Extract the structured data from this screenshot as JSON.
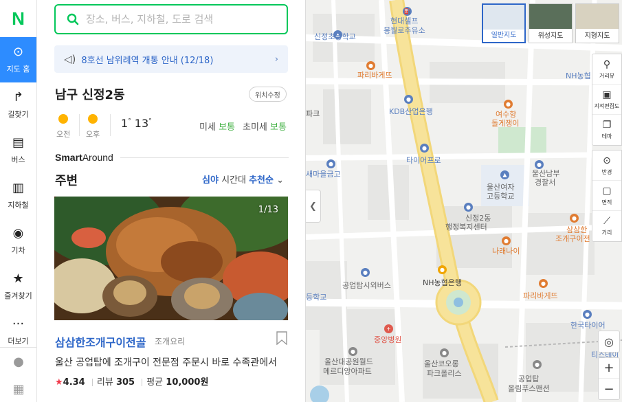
{
  "nav": {
    "logo": "N",
    "items": [
      {
        "label": "지도 홈",
        "icon": "map-home-icon",
        "glyph": "⊙",
        "active": true
      },
      {
        "label": "길찾기",
        "icon": "directions-icon",
        "glyph": "↱",
        "active": false
      },
      {
        "label": "버스",
        "icon": "bus-icon",
        "glyph": "▤",
        "active": false
      },
      {
        "label": "지하철",
        "icon": "subway-icon",
        "glyph": "▥",
        "active": false
      },
      {
        "label": "기차",
        "icon": "train-icon",
        "glyph": "◉",
        "active": false
      },
      {
        "label": "즐겨찾기",
        "icon": "star-icon",
        "glyph": "★",
        "active": false
      },
      {
        "label": "더보기",
        "icon": "more-icon",
        "glyph": "···",
        "active": false
      }
    ],
    "bottom": [
      {
        "icon": "profile-icon",
        "glyph": "●"
      },
      {
        "icon": "grid-icon",
        "glyph": "▦"
      }
    ]
  },
  "search": {
    "placeholder": "장소, 버스, 지하철, 도로 검색",
    "value": ""
  },
  "notice": {
    "text": "8호선 남위례역 개통 안내 (12/18)"
  },
  "location": {
    "name": "남구 신정2동",
    "edit_button": "위치수정"
  },
  "weather": {
    "am_label": "오전",
    "pm_label": "오후",
    "low": "1",
    "high": "13",
    "degree": "°",
    "fine_dust_label": "미세",
    "fine_dust_value": "보통",
    "ultra_dust_label": "초미세",
    "ultra_dust_value": "보통"
  },
  "smart_around": {
    "brand_bold": "Smart",
    "brand_rest": "Around"
  },
  "around": {
    "title": "주변",
    "filter_time": "심야",
    "filter_mid": "시간대",
    "filter_sort": "추천순"
  },
  "place": {
    "photo_count": "1/13",
    "name": "삼삼한조개구이전골",
    "category": "조개요리",
    "description": "울산 공업탑에 조개구이 전문점 주문시 바로 수족관에서",
    "rating": "4.34",
    "review_label": "리뷰",
    "review_count": "305",
    "price_label": "평균",
    "price": "10,000원"
  },
  "map_layers": [
    {
      "label": "일반지도",
      "selected": true
    },
    {
      "label": "위성지도",
      "selected": false
    },
    {
      "label": "지형지도",
      "selected": false
    }
  ],
  "map_tools": [
    {
      "label": "거리뷰",
      "icon": "street-view-icon",
      "glyph": "⚲"
    },
    {
      "label": "지적편집도",
      "icon": "cadastral-icon",
      "glyph": "▣"
    },
    {
      "label": "테마",
      "icon": "theme-icon",
      "glyph": "❐"
    }
  ],
  "map_tools2": [
    {
      "label": "반경",
      "icon": "radius-icon",
      "glyph": "⊙"
    },
    {
      "label": "면적",
      "icon": "area-icon",
      "glyph": "▢"
    },
    {
      "label": "거리",
      "icon": "ruler-icon",
      "glyph": "⟋"
    }
  ],
  "map_labels": {
    "hyundai_self": "현대셀프",
    "bongwol_oil": "봉월로주유소",
    "sinjeong_elem": "신정초등학교",
    "paris1": "파리바게뜨",
    "nh1": "NH농협",
    "paka": "파크",
    "kdb": "KDB산업은행",
    "yeosuhang": "여수항",
    "dolgeje": "돌게쟁이",
    "tire": "타이어프로",
    "saemaeul": "새마을금고",
    "ulsan_namboo": "울산남부",
    "police": "경찰서",
    "ulsan_girls": "울산여자",
    "highschool": "고등학교",
    "sinjeong2": "신정2동",
    "admin_center": "행정복지센터",
    "samsam": "삼삼한",
    "jogae": "조개구이전",
    "narenai": "나래나이",
    "gongeop_bus": "공업탑시외버스",
    "nh_bank": "NH농협은행",
    "school": "등학교",
    "paris2": "파리바게뜨",
    "korea_tire": "한국타이어",
    "tire_station": "티스테이",
    "jungang": "중앙병원",
    "ulsan_park1": "울산대공원월드",
    "ulsan_park2": "메르디앙아파트",
    "ulsan_koryong1": "울산코오롱",
    "ulsan_koryong2": "파크폴리스",
    "gongeoptap": "공업탑",
    "olympus": "올림푸스맨션"
  },
  "colors": {
    "accent_green": "#03c75a",
    "active_blue": "#2d8cff",
    "link_blue": "#2d66c8",
    "dust_green": "#48b34a",
    "star_red": "#f0394a",
    "road_yellow": "#f7e39a"
  }
}
